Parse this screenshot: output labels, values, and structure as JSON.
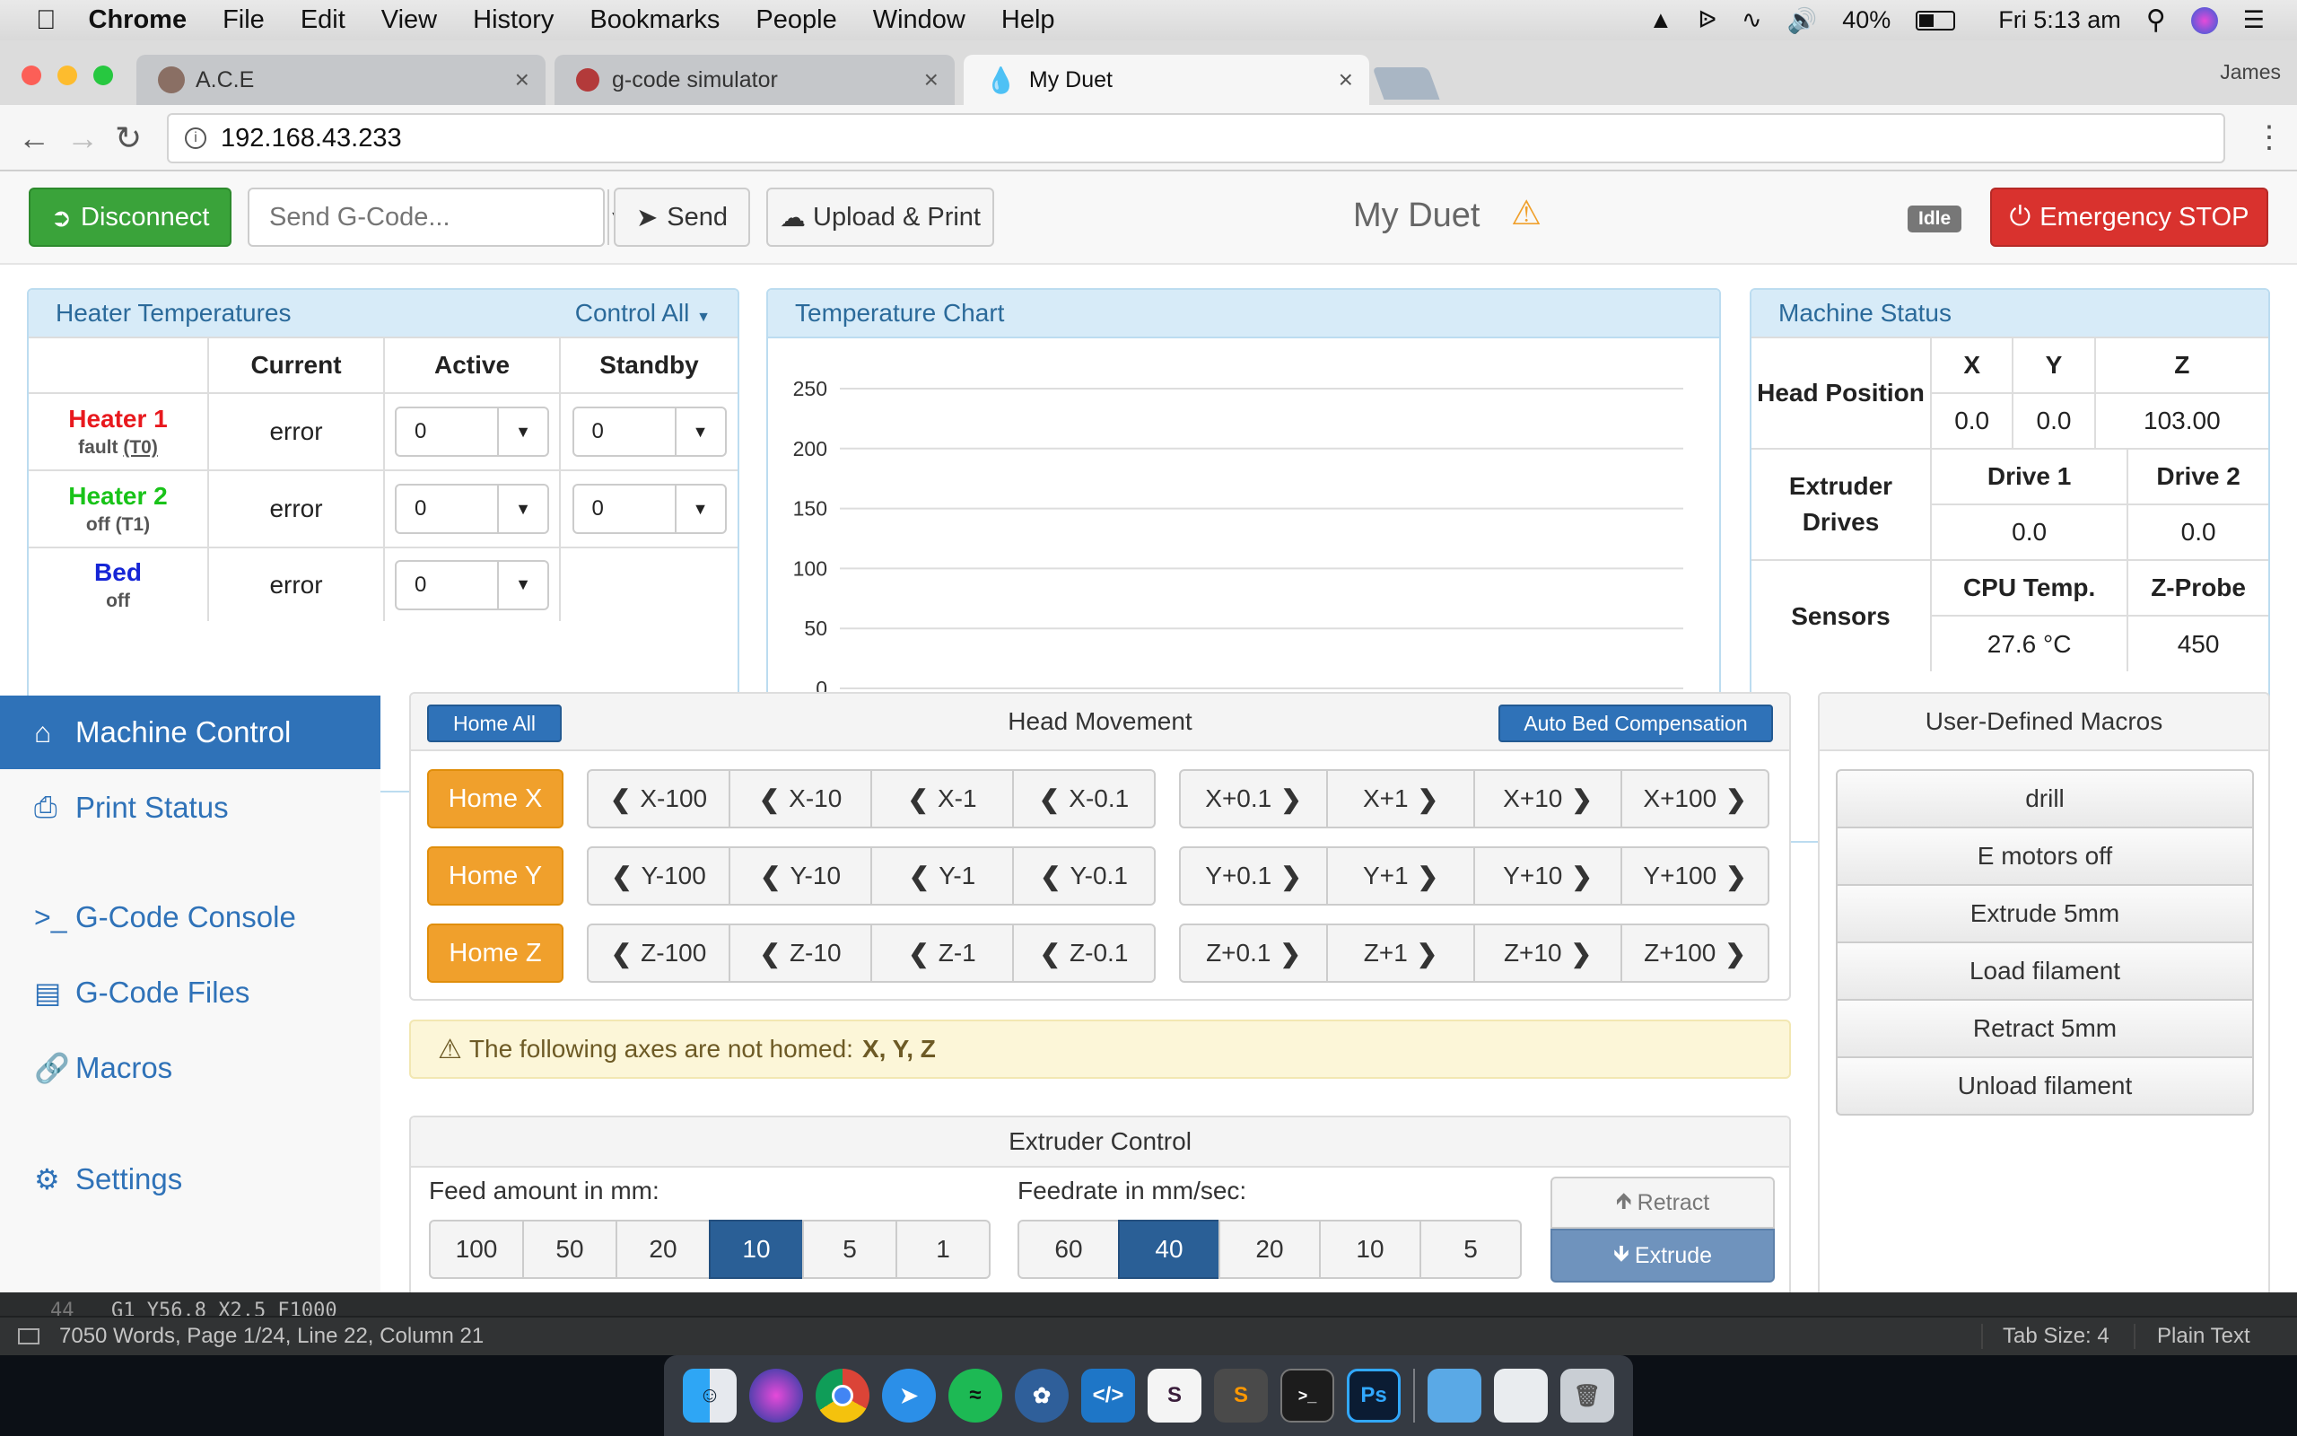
{
  "menubar": {
    "app": "Chrome",
    "items": [
      "File",
      "Edit",
      "View",
      "History",
      "Bookmarks",
      "People",
      "Window",
      "Help"
    ],
    "battery": "40%",
    "clock": "Fri 5:13 am"
  },
  "browser": {
    "tabs": [
      {
        "label": "A.C.E"
      },
      {
        "label": "g-code simulator"
      },
      {
        "label": "My Duet"
      }
    ],
    "profile": "James",
    "url": "192.168.43.233"
  },
  "toolbar": {
    "disconnect": "Disconnect",
    "gcode_placeholder": "Send G-Code...",
    "send": "Send",
    "upload": "Upload & Print",
    "title": "My Duet",
    "status": "Idle",
    "estop": "Emergency STOP"
  },
  "heaters": {
    "title": "Heater Temperatures",
    "control_all": "Control All",
    "columns": [
      "Current",
      "Active",
      "Standby"
    ],
    "rows": [
      {
        "name": "Heater 1",
        "sub": "fault",
        "tool": "(T0)",
        "current": "error",
        "active": "0",
        "standby": "0",
        "color": "#e8191e"
      },
      {
        "name": "Heater 2",
        "sub": "off",
        "tool": "(T1)",
        "current": "error",
        "active": "0",
        "standby": "0",
        "color": "#19c319"
      },
      {
        "name": "Bed",
        "sub": "off",
        "tool": "",
        "current": "error",
        "active": "0",
        "standby": "",
        "color": "#1525d6"
      }
    ]
  },
  "chart": {
    "title": "Temperature Chart",
    "yticks": [
      "250",
      "200",
      "150",
      "100",
      "50",
      "0"
    ]
  },
  "chart_data": {
    "type": "line",
    "title": "Temperature Chart",
    "ylim": [
      0,
      250
    ],
    "yticks": [
      0,
      50,
      100,
      150,
      200,
      250
    ],
    "series": [],
    "grid": true
  },
  "machine_status": {
    "title": "Machine Status",
    "head_position": "Head Position",
    "axes": [
      "X",
      "Y",
      "Z"
    ],
    "positions": [
      "0.0",
      "0.0",
      "103.00"
    ],
    "extruder_drives": "Extruder Drives",
    "drives": [
      "Drive 1",
      "Drive 2"
    ],
    "drive_values": [
      "0.0",
      "0.0"
    ],
    "sensors": "Sensors",
    "sensor_labels": [
      "CPU Temp.",
      "Z-Probe"
    ],
    "sensor_values": [
      "27.6 °C",
      "450"
    ]
  },
  "sidebar": {
    "items": [
      {
        "label": "Machine Control"
      },
      {
        "label": "Print Status"
      },
      {
        "label": "G-Code Console"
      },
      {
        "label": "G-Code Files"
      },
      {
        "label": "Macros"
      },
      {
        "label": "Settings"
      }
    ]
  },
  "head_movement": {
    "title": "Head Movement",
    "home_all": "Home All",
    "auto_bed": "Auto Bed Compensation",
    "home_buttons": [
      "Home X",
      "Home Y",
      "Home Z"
    ],
    "rows": [
      {
        "neg": [
          "X-100",
          "X-10",
          "X-1",
          "X-0.1"
        ],
        "pos": [
          "X+0.1",
          "X+1",
          "X+10",
          "X+100"
        ]
      },
      {
        "neg": [
          "Y-100",
          "Y-10",
          "Y-1",
          "Y-0.1"
        ],
        "pos": [
          "Y+0.1",
          "Y+1",
          "Y+10",
          "Y+100"
        ]
      },
      {
        "neg": [
          "Z-100",
          "Z-10",
          "Z-1",
          "Z-0.1"
        ],
        "pos": [
          "Z+0.1",
          "Z+1",
          "Z+10",
          "Z+100"
        ]
      }
    ]
  },
  "warning": {
    "text": "The following axes are not homed:",
    "axes": "X, Y, Z"
  },
  "macros": {
    "title": "User-Defined Macros",
    "items": [
      "drill",
      "E motors off",
      "Extrude 5mm",
      "Load filament",
      "Retract 5mm",
      "Unload filament"
    ]
  },
  "extruder": {
    "title": "Extruder Control",
    "feed_label": "Feed amount in mm:",
    "feed_options": [
      "100",
      "50",
      "20",
      "10",
      "5",
      "1"
    ],
    "feed_selected": "10",
    "rate_label": "Feedrate in mm/sec:",
    "rate_options": [
      "60",
      "40",
      "20",
      "10",
      "5"
    ],
    "rate_selected": "40",
    "retract": "Retract",
    "extrude": "Extrude"
  },
  "editor_status": {
    "text": "7050 Words, Page 1/24, Line 22, Column 21",
    "code_line_num": "44",
    "code_line": "G1 Y56.8 X2.5 F1000",
    "tab_size": "Tab Size: 4",
    "syntax": "Plain Text"
  }
}
